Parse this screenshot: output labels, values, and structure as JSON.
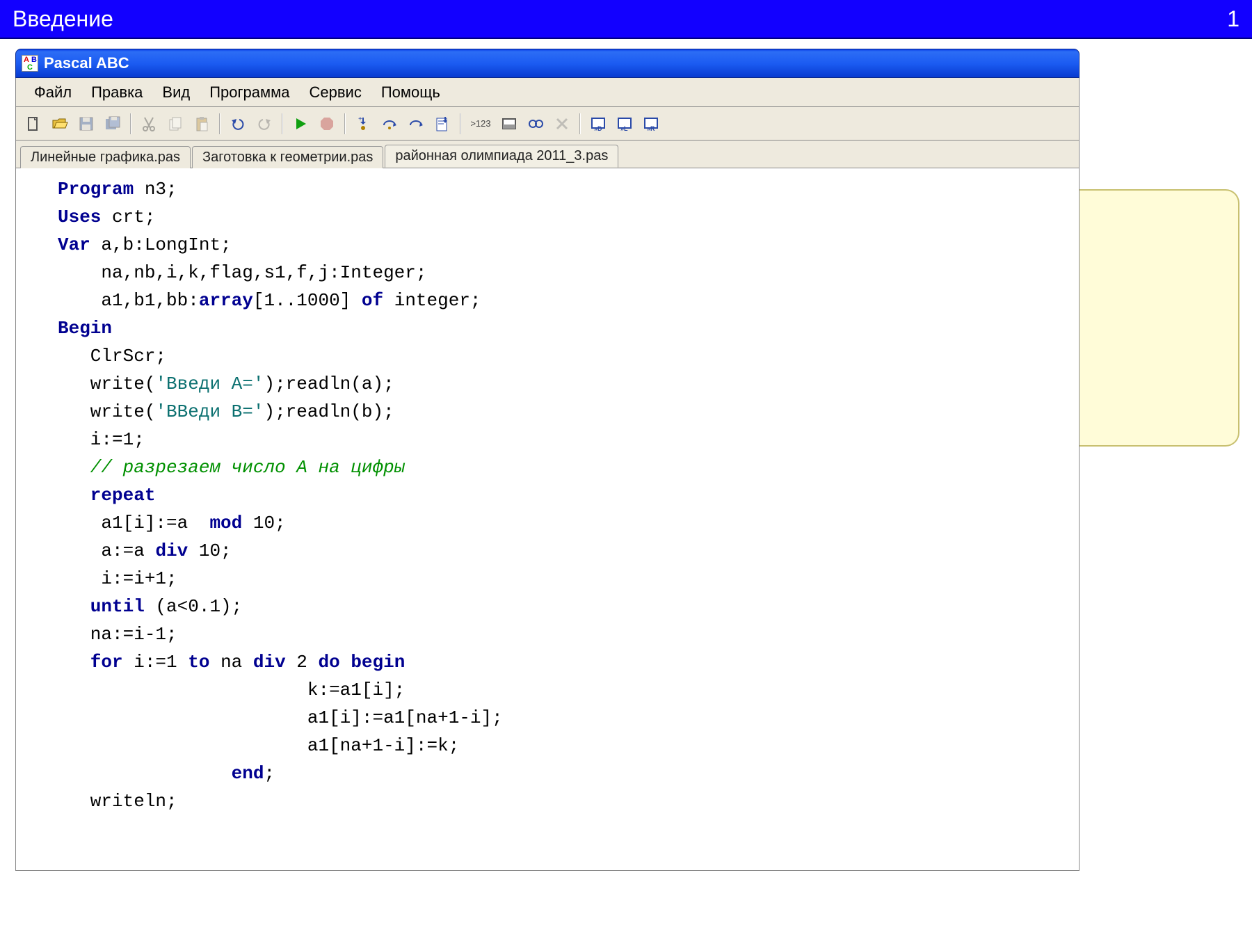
{
  "slide": {
    "title": "Введение",
    "page": "1"
  },
  "app": {
    "title": "Pascal ABC"
  },
  "menu": {
    "file": "Файл",
    "edit": "Правка",
    "view": "Вид",
    "program": "Программа",
    "service": "Сервис",
    "help": "Помощь"
  },
  "toolbar_labels": {
    "vars": ">123"
  },
  "tabs": {
    "t1": "Линейные графика.pas",
    "t2": "Заготовка к геометрии.pas",
    "t3": "районная олимпиада 2011_3.pas"
  },
  "code": {
    "l1a": "Program",
    "l1b": " n3;",
    "l2a": "Uses",
    "l2b": " crt;",
    "l3a": "Var",
    "l3b": " a,b:LongInt;",
    "l4": "    na,nb,i,k,flag,s1,f,j:Integer;",
    "l5a": "    a1,b1,bb:",
    "l5b": "array",
    "l5c": "[1..1000] ",
    "l5d": "of",
    "l5e": " integer;",
    "l6": "Begin",
    "l7": "   ClrScr;",
    "l8a": "   write(",
    "l8b": "'Введи A='",
    "l8c": ");readln(a);",
    "l9a": "   write(",
    "l9b": "'ВВеди B='",
    "l9c": ");readln(b);",
    "l10": "   i:=1;",
    "l11": "   // разрезаем число A на цифры",
    "l12": "   repeat",
    "l13a": "    a1[i]:=a  ",
    "l13b": "mod",
    "l13c": " 10;",
    "l14a": "    a:=a ",
    "l14b": "div",
    "l14c": " 10;",
    "l15": "    i:=i+1;",
    "l16a": "   until",
    "l16b": " (a<0.1);",
    "l17": "   na:=i-1;",
    "l18a": "   for",
    "l18b": " i:=1 ",
    "l18c": "to",
    "l18d": " na ",
    "l18e": "div",
    "l18f": " 2 ",
    "l18g": "do begin",
    "l19": "                       k:=a1[i];",
    "l20": "                       a1[i]:=a1[na+1-i];",
    "l21": "                       a1[na+1-i]:=k;",
    "l22a": "                ",
    "l22b": "end",
    "l22c": ";",
    "l23": "   writeln;"
  }
}
